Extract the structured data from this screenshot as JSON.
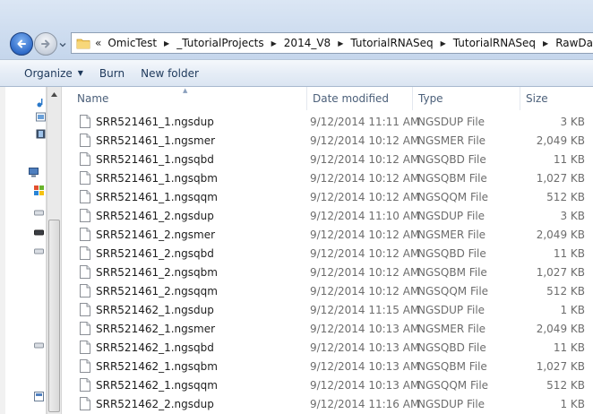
{
  "address_bar": {
    "overflow": "«",
    "breadcrumbs": [
      "OmicTest",
      "_TutorialProjects",
      "2014_V8",
      "TutorialRNASeq",
      "TutorialRNASeq",
      "RawDataQC"
    ]
  },
  "toolbar": {
    "organize_label": "Organize",
    "burn_label": "Burn",
    "new_folder_label": "New folder"
  },
  "columns": {
    "name": "Name",
    "date": "Date modified",
    "type": "Type",
    "size": "Size"
  },
  "files": [
    {
      "name": "SRR521461_1.ngsdup",
      "date": "9/12/2014 11:11 AM",
      "type": "NGSDUP File",
      "size": "3 KB"
    },
    {
      "name": "SRR521461_1.ngsmer",
      "date": "9/12/2014 10:12 AM",
      "type": "NGSMER File",
      "size": "2,049 KB"
    },
    {
      "name": "SRR521461_1.ngsqbd",
      "date": "9/12/2014 10:12 AM",
      "type": "NGSQBD File",
      "size": "11 KB"
    },
    {
      "name": "SRR521461_1.ngsqbm",
      "date": "9/12/2014 10:12 AM",
      "type": "NGSQBM File",
      "size": "1,027 KB"
    },
    {
      "name": "SRR521461_1.ngsqqm",
      "date": "9/12/2014 10:12 AM",
      "type": "NGSQQM File",
      "size": "512 KB"
    },
    {
      "name": "SRR521461_2.ngsdup",
      "date": "9/12/2014 11:10 AM",
      "type": "NGSDUP File",
      "size": "3 KB"
    },
    {
      "name": "SRR521461_2.ngsmer",
      "date": "9/12/2014 10:12 AM",
      "type": "NGSMER File",
      "size": "2,049 KB"
    },
    {
      "name": "SRR521461_2.ngsqbd",
      "date": "9/12/2014 10:12 AM",
      "type": "NGSQBD File",
      "size": "11 KB"
    },
    {
      "name": "SRR521461_2.ngsqbm",
      "date": "9/12/2014 10:12 AM",
      "type": "NGSQBM File",
      "size": "1,027 KB"
    },
    {
      "name": "SRR521461_2.ngsqqm",
      "date": "9/12/2014 10:12 AM",
      "type": "NGSQQM File",
      "size": "512 KB"
    },
    {
      "name": "SRR521462_1.ngsdup",
      "date": "9/12/2014 11:15 AM",
      "type": "NGSDUP File",
      "size": "1 KB"
    },
    {
      "name": "SRR521462_1.ngsmer",
      "date": "9/12/2014 10:13 AM",
      "type": "NGSMER File",
      "size": "2,049 KB"
    },
    {
      "name": "SRR521462_1.ngsqbd",
      "date": "9/12/2014 10:13 AM",
      "type": "NGSQBD File",
      "size": "11 KB"
    },
    {
      "name": "SRR521462_1.ngsqbm",
      "date": "9/12/2014 10:13 AM",
      "type": "NGSQBM File",
      "size": "1,027 KB"
    },
    {
      "name": "SRR521462_1.ngsqqm",
      "date": "9/12/2014 10:13 AM",
      "type": "NGSQQM File",
      "size": "512 KB"
    },
    {
      "name": "SRR521462_2.ngsdup",
      "date": "9/12/2014 11:16 AM",
      "type": "NGSDUP File",
      "size": "1 KB"
    }
  ]
}
